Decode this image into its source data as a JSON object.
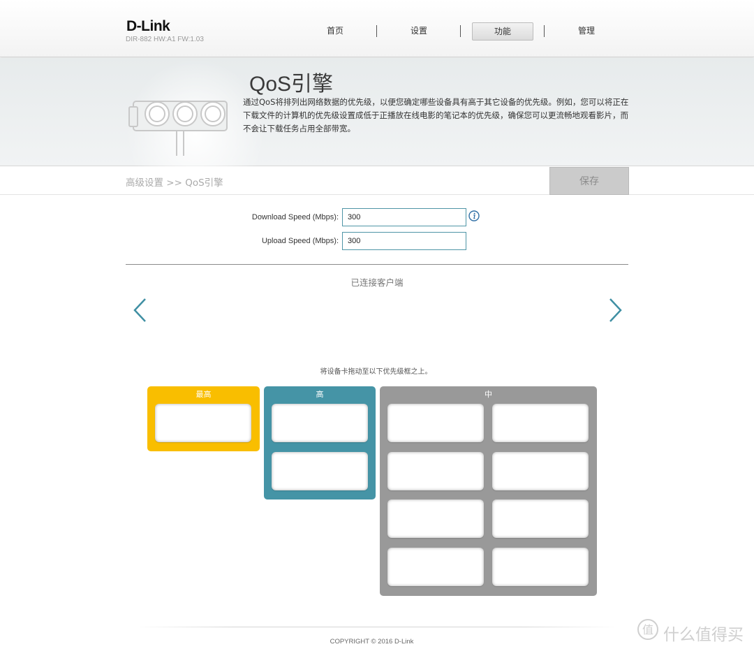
{
  "header": {
    "logo": "D-Link",
    "device_info": "DIR-882 HW:A1 FW:1.03",
    "nav": [
      {
        "label": "首页",
        "active": false
      },
      {
        "label": "设置",
        "active": false
      },
      {
        "label": "功能",
        "active": true
      },
      {
        "label": "管理",
        "active": false
      }
    ]
  },
  "banner": {
    "title": "QoS引擎",
    "description": "通过QoS将排列出网络数据的优先级，以便您确定哪些设备具有高于其它设备的优先级。例如，您可以将正在下载文件的计算机的优先级设置成低于正播放在线电影的笔记本的优先级，确保您可以更流畅地观看影片，而不会让下载任务占用全部带宽。"
  },
  "breadcrumb": "高级设置 >> QoS引擎",
  "save_label": "保存",
  "form": {
    "download_label": "Download Speed (Mbps):",
    "download_value": "300",
    "upload_label": "Upload Speed (Mbps):",
    "upload_value": "300"
  },
  "clients": {
    "title": "已连接客户端"
  },
  "drag_hint": "将设备卡拖动至以下优先级框之上。",
  "priority": {
    "highest": {
      "label": "最高",
      "color": "#f9be00"
    },
    "high": {
      "label": "高",
      "color": "#4594a6"
    },
    "medium": {
      "label": "中",
      "color": "#999999"
    }
  },
  "colors": {
    "accent": "#4594a6",
    "arrow": "#3f8fa3"
  },
  "footer": "COPYRIGHT © 2016 D-Link",
  "watermark": {
    "icon": "zhi-badge-icon",
    "text": "什么值得买"
  }
}
